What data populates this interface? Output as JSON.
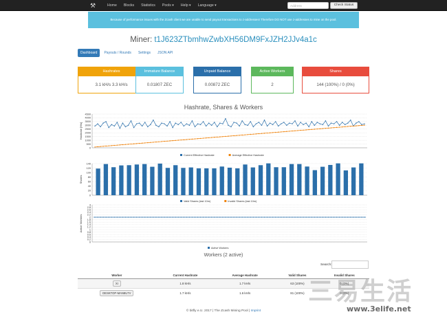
{
  "nav": {
    "links": [
      "Home",
      "Blocks",
      "Statistics",
      "Pools ▾",
      "Help ▾",
      "Language ▾"
    ],
    "address_placeholder": "Address",
    "check_button": "Check Status"
  },
  "alert": "Because of performance issues with the Zcash client we are unable to send payout transactions to z-addresses! Therefore DO NOT use z-addresses to mine on the pool.",
  "miner": {
    "label": "Miner:",
    "address": "t1J623ZTbmhwZwbXH56DM9FxJZH2JJv4a1c"
  },
  "tabs": [
    "Dashboard",
    "Payouts / Rounds",
    "Settings",
    "JSON API"
  ],
  "cards": [
    {
      "title": "Hashrates",
      "value": "3.1 kH/s   3.3 kH/s",
      "color": "#f0a30a"
    },
    {
      "title": "Immature Balance",
      "value": "0.01807 ZEC",
      "color": "#5bc0de"
    },
    {
      "title": "Unpaid Balance",
      "value": "0.00872 ZEC",
      "color": "#2b6faa"
    },
    {
      "title": "Active Workers",
      "value": "2",
      "color": "#5cb85c"
    },
    {
      "title": "Shares",
      "value": "144 (100%) / 0 (0%)",
      "color": "#e84c3d"
    }
  ],
  "chart_data": [
    {
      "type": "line",
      "title": "Hashrate, Shares & Workers",
      "ylabel": "Hashrate [H/s]",
      "ylim": [
        0,
        4500
      ],
      "yticks": [
        0,
        500,
        1000,
        1500,
        2000,
        2500,
        3000,
        3500,
        4000,
        4500
      ],
      "series": [
        {
          "name": "Current Effective Hashrate",
          "color": "#2b6faa",
          "values": [
            2900,
            3200,
            2800,
            3300,
            3500,
            2700,
            3100,
            2900,
            3400,
            2600,
            3300,
            2800,
            3000,
            3600,
            2700,
            3200,
            3300,
            2900,
            3400,
            2800,
            3100,
            3700,
            3000,
            2800,
            3300,
            3200,
            2900,
            3500,
            2700,
            3300,
            3100,
            3400,
            2900,
            3200,
            3000,
            3600,
            2800,
            3200,
            3100,
            3500,
            2900,
            3300,
            3000,
            3400,
            2800,
            3300,
            3200,
            3900,
            3000,
            2800,
            3400,
            3300,
            2900,
            3600,
            3100,
            3000,
            3500,
            2800,
            3200,
            3400,
            3000,
            3700,
            2900,
            3300,
            3100,
            3500,
            2900,
            3200,
            3400,
            3000,
            3300,
            3200,
            3600,
            2900,
            3400,
            3100,
            3300,
            2800,
            3500,
            3000,
            3400,
            3200,
            3100,
            3600,
            2900,
            3300,
            3200,
            3500,
            3000,
            3400,
            3100,
            3300,
            3700,
            2900,
            3300,
            3500,
            3100,
            3200
          ]
        },
        {
          "name": "Average Effective Hashrate",
          "color": "#f0820a",
          "values": [
            100,
            140,
            170,
            200,
            230,
            260,
            290,
            320,
            350,
            380,
            410,
            440,
            470,
            500,
            530,
            560,
            590,
            620,
            650,
            680,
            710,
            740,
            770,
            800,
            830,
            860,
            890,
            920,
            950,
            980,
            1010,
            1040,
            1070,
            1100,
            1130,
            1160,
            1190,
            1220,
            1250,
            1280,
            1310,
            1340,
            1370,
            1400,
            1430,
            1460,
            1490,
            1520,
            1550,
            1580,
            1610,
            1640,
            1670,
            1700,
            1730,
            1760,
            1790,
            1820,
            1850,
            1880,
            1910,
            1940,
            1970,
            2000,
            2030,
            2060,
            2090,
            2120,
            2150,
            2180,
            2210,
            2240,
            2270,
            2300,
            2330,
            2360,
            2390,
            2420,
            2450,
            2480,
            2510,
            2540,
            2570,
            2600,
            2630,
            2660,
            2690,
            2720,
            2750,
            2780,
            2810,
            2840,
            2870,
            2900,
            2930,
            2960,
            2990,
            3020
          ]
        }
      ]
    },
    {
      "type": "bar",
      "ylabel": "Shares",
      "ylim": [
        0,
        140
      ],
      "yticks": [
        0,
        20,
        40,
        60,
        80,
        100,
        120,
        140
      ],
      "series": [
        {
          "name": "Valid Shares (last 10m)",
          "color": "#2b6faa",
          "values": [
            118,
            138,
            124,
            132,
            133,
            136,
            138,
            126,
            140,
            121,
            133,
            121,
            123,
            119,
            119,
            119,
            127,
            122,
            119,
            136,
            123,
            133,
            141,
            124,
            124,
            138,
            138,
            127,
            111,
            126,
            134,
            141,
            110,
            123,
            141
          ]
        },
        {
          "name": "Invalid Shares (last 10m)",
          "color": "#f0820a",
          "values": [
            0
          ]
        }
      ]
    },
    {
      "type": "line",
      "ylabel": "Active Workers",
      "ylim": [
        0,
        3
      ],
      "yticks": [
        0,
        0.2,
        0.4,
        0.6,
        0.8,
        1,
        1.2,
        1.4,
        1.6,
        1.8,
        2,
        2.2,
        2.4,
        2.6,
        2.8,
        3
      ],
      "series": [
        {
          "name": "Active Workers",
          "color": "#2b6faa",
          "values": [
            2
          ]
        }
      ]
    }
  ],
  "workers": {
    "title": "Workers (2 active)",
    "search_label": "Search:",
    "columns": [
      "Worker",
      "Current Hashrate",
      "Average Hashrate",
      "Valid Shares",
      "Invalid Shares"
    ],
    "rows": [
      [
        "XI",
        "1.8 kH/s",
        "1.7 kH/s",
        "63 (100%)",
        "0 (0%)"
      ],
      [
        "DESKTOP-MAN8U7V",
        "1.7 kH/s",
        "1.6 kH/s",
        "81 (100%)",
        "0 (0%)"
      ]
    ]
  },
  "footer": {
    "text": "© bitfly e.U. 2017 | The Zcash Mining Pool | ",
    "imprint": "Imprint"
  },
  "watermark": {
    "text": "三易生活",
    "url": "www.3elife.net"
  }
}
